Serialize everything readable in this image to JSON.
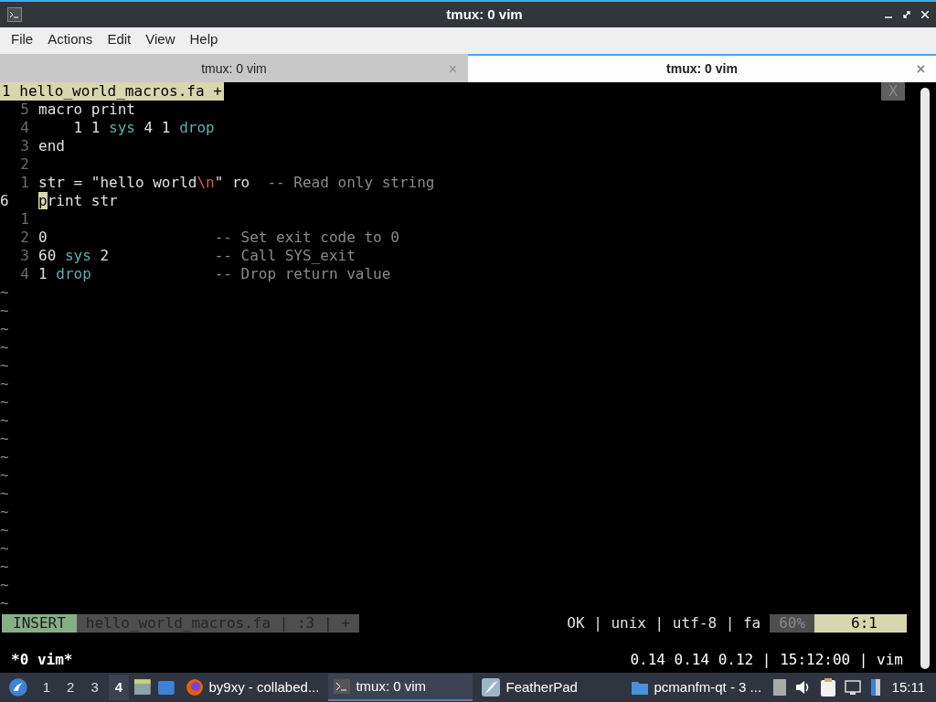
{
  "window": {
    "title": "tmux: 0 vim"
  },
  "menu": [
    "File",
    "Actions",
    "Edit",
    "View",
    "Help"
  ],
  "tabs": [
    {
      "label": "tmux: 0 vim",
      "close": "×",
      "selected": false
    },
    {
      "label": "tmux: 0 vim",
      "close": "×",
      "selected": true
    }
  ],
  "vim": {
    "tabline": {
      "label": "1 hello_world_macros.fa +",
      "close": "X"
    },
    "lines": [
      {
        "number": "5",
        "current": false,
        "segments": [
          {
            "text": "macro print",
            "kind": "plain"
          }
        ]
      },
      {
        "number": "4",
        "current": false,
        "segments": [
          {
            "text": "    1 1 ",
            "kind": "plain"
          },
          {
            "text": "sys",
            "kind": "keyword"
          },
          {
            "text": " 4 1 ",
            "kind": "plain"
          },
          {
            "text": "drop",
            "kind": "keyword"
          }
        ]
      },
      {
        "number": "3",
        "current": false,
        "segments": [
          {
            "text": "end",
            "kind": "plain"
          }
        ]
      },
      {
        "number": "2",
        "current": false
      },
      {
        "number": "1",
        "current": false,
        "segments": [
          {
            "text": "str = \"hello world",
            "kind": "plain"
          },
          {
            "text": "\\n",
            "kind": "escape"
          },
          {
            "text": "\" ro  ",
            "kind": "plain"
          },
          {
            "text": "-- Read only string",
            "kind": "comment"
          }
        ]
      },
      {
        "number": "6",
        "current": true,
        "segments": [
          {
            "text": "p",
            "kind": "cursor"
          },
          {
            "text": "rint str",
            "kind": "plain"
          }
        ]
      },
      {
        "number": "1",
        "current": false
      },
      {
        "number": "2",
        "current": false,
        "segments": [
          {
            "text": "0                   ",
            "kind": "plain"
          },
          {
            "text": "-- Set exit code to 0",
            "kind": "comment"
          }
        ]
      },
      {
        "number": "3",
        "current": false,
        "segments": [
          {
            "text": "60 ",
            "kind": "plain"
          },
          {
            "text": "sys",
            "kind": "keyword"
          },
          {
            "text": " 2            ",
            "kind": "plain"
          },
          {
            "text": "-- Call SYS_exit",
            "kind": "comment"
          }
        ]
      },
      {
        "number": "4",
        "current": false,
        "segments": [
          {
            "text": "1 ",
            "kind": "plain"
          },
          {
            "text": "drop",
            "kind": "keyword"
          },
          {
            "text": "              -- Drop return value",
            "kind": "comment"
          }
        ]
      }
    ],
    "filler": [
      "~",
      "~",
      "~",
      "~",
      "~",
      "~",
      "~",
      "~",
      "~",
      "~",
      "~",
      "~",
      "~",
      "~",
      "~",
      "~",
      "~",
      "~"
    ],
    "statusline": {
      "mode": "INSERT",
      "file": "hello_world_macros.fa | :3 | +",
      "info": "OK | unix | utf-8 | fa",
      "percent": "60%",
      "position": "6:1"
    }
  },
  "tmux_status": {
    "left": "*0 vim*",
    "right": "0.14 0.14 0.12 | 15:12:00 | vim"
  },
  "taskbar": {
    "workspaces": [
      {
        "label": "1",
        "selected": false
      },
      {
        "label": "2",
        "selected": false
      },
      {
        "label": "3",
        "selected": false
      },
      {
        "label": "4",
        "selected": true
      }
    ],
    "tasks": [
      {
        "kind": "browser",
        "label": "by9xy - collabed...",
        "selected": false
      },
      {
        "kind": "terminal",
        "label": "tmux: 0 vim",
        "selected": true
      },
      {
        "kind": "editor",
        "label": "FeatherPad",
        "selected": false
      },
      {
        "kind": "folder",
        "label": "pcmanfm-qt - 3 ...",
        "selected": false
      }
    ],
    "clock": "15:11"
  }
}
